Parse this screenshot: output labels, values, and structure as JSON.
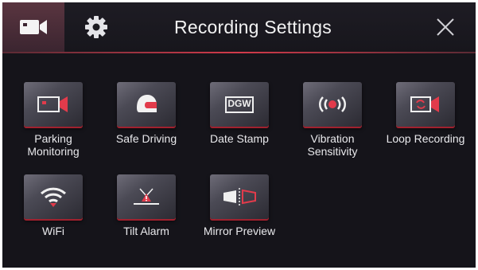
{
  "header": {
    "title": "Recording Settings",
    "tabs": [
      {
        "icon": "video-camera-icon",
        "active": true
      },
      {
        "icon": "gear-icon",
        "active": false
      }
    ],
    "close_icon": "close-icon"
  },
  "colors": {
    "background": "#15141a",
    "accent": "#d23a4a",
    "tile": "#4b4a55",
    "text": "#e9e9ec"
  },
  "settings": [
    {
      "label_1": "Parking",
      "label_2": "Monitoring",
      "icon": "parking-camera-icon"
    },
    {
      "label_1": "Safe Driving",
      "label_2": "",
      "icon": "helmet-icon"
    },
    {
      "label_1": "Date Stamp",
      "label_2": "",
      "icon": "date-stamp-icon",
      "badge": "DGW"
    },
    {
      "label_1": "Vibration",
      "label_2": "Sensitivity",
      "icon": "vibration-icon"
    },
    {
      "label_1": "Loop Recording",
      "label_2": "",
      "icon": "loop-recording-icon"
    },
    {
      "label_1": "WiFi",
      "label_2": "",
      "icon": "wifi-icon"
    },
    {
      "label_1": "Tilt Alarm",
      "label_2": "",
      "icon": "tilt-alarm-icon"
    },
    {
      "label_1": "Mirror Preview",
      "label_2": "",
      "icon": "mirror-preview-icon"
    }
  ]
}
